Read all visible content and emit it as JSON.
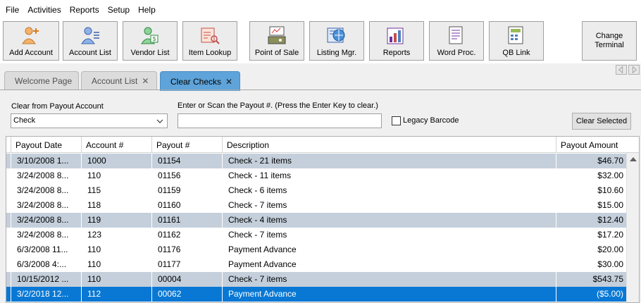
{
  "menu": [
    "File",
    "Activities",
    "Reports",
    "Setup",
    "Help"
  ],
  "toolbar": {
    "buttons": [
      {
        "label": "Add Account",
        "icon": "add-account-icon"
      },
      {
        "label": "Account List",
        "icon": "account-list-icon"
      },
      {
        "label": "Vendor List",
        "icon": "vendor-list-icon"
      },
      {
        "label": "Item Lookup",
        "icon": "item-lookup-icon"
      },
      {
        "label": "Point of Sale",
        "icon": "point-of-sale-icon"
      },
      {
        "label": "Listing Mgr.",
        "icon": "listing-manager-icon"
      },
      {
        "label": "Reports",
        "icon": "reports-icon"
      },
      {
        "label": "Word Proc.",
        "icon": "word-processor-icon"
      },
      {
        "label": "QB Link",
        "icon": "qb-link-icon"
      }
    ],
    "change_terminal": {
      "line1": "Change",
      "line2": "Terminal"
    }
  },
  "tabs": [
    {
      "label": "Welcome Page",
      "closable": false
    },
    {
      "label": "Account List",
      "closable": true
    },
    {
      "label": "Clear Checks",
      "closable": true,
      "active": true
    }
  ],
  "form": {
    "account_label": "Clear from Payout Account",
    "account_value": "Check",
    "scan_label": "Enter or Scan the Payout #.  (Press the Enter Key to clear.)",
    "scan_value": "",
    "legacy_label": "Legacy Barcode",
    "legacy_checked": false,
    "clear_button": "Clear Selected"
  },
  "table": {
    "columns": [
      "Payout Date",
      "Account #",
      "Payout #",
      "Description",
      "Payout Amount"
    ],
    "rows": [
      {
        "date": "3/10/2008 1...",
        "account": "1000",
        "payout": "01154",
        "description": "Check - 21 items",
        "amount": "$46.70",
        "style": "alt"
      },
      {
        "date": "3/24/2008 8...",
        "account": "110",
        "payout": "01156",
        "description": "Check - 11 items",
        "amount": "$32.00",
        "style": "plain"
      },
      {
        "date": "3/24/2008 8...",
        "account": "115",
        "payout": "01159",
        "description": "Check - 6 items",
        "amount": "$10.60",
        "style": "plain"
      },
      {
        "date": "3/24/2008 8...",
        "account": "118",
        "payout": "01160",
        "description": "Check - 7 items",
        "amount": "$15.00",
        "style": "plain"
      },
      {
        "date": "3/24/2008 8...",
        "account": "119",
        "payout": "01161",
        "description": "Check - 4 items",
        "amount": "$12.40",
        "style": "alt"
      },
      {
        "date": "3/24/2008 8...",
        "account": "123",
        "payout": "01162",
        "description": "Check - 7 items",
        "amount": "$17.20",
        "style": "plain"
      },
      {
        "date": "6/3/2008 11...",
        "account": "110",
        "payout": "01176",
        "description": "Payment Advance",
        "amount": "$20.00",
        "style": "plain"
      },
      {
        "date": "6/3/2008 4:...",
        "account": "110",
        "payout": "01177",
        "description": "Payment Advance",
        "amount": "$30.00",
        "style": "plain"
      },
      {
        "date": "10/15/2012 ...",
        "account": "110",
        "payout": "00004",
        "description": "Check - 7 items",
        "amount": "$543.75",
        "style": "alt"
      },
      {
        "date": "3/2/2018 12...",
        "account": "112",
        "payout": "00062",
        "description": "Payment Advance",
        "amount": "($5.00)",
        "style": "sel"
      }
    ]
  }
}
